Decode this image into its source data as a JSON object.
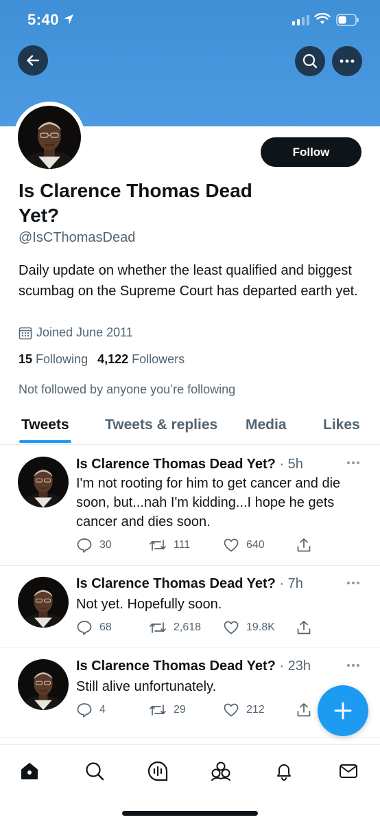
{
  "status_bar": {
    "time": "5:40"
  },
  "profile": {
    "name": "Is Clarence Thomas Dead Yet?",
    "handle": "@IsCThomasDead",
    "bio": "Daily update on whether the least qualified and biggest scumbag on the Supreme Court has departed earth yet.",
    "joined": "Joined June 2011",
    "following_count": "15",
    "following_label": "Following",
    "followers_count": "4,122",
    "followers_label": "Followers",
    "not_followed_note": "Not followed by anyone you’re following",
    "follow_button": "Follow"
  },
  "tabs": [
    {
      "label": "Tweets",
      "active": true
    },
    {
      "label": "Tweets & replies",
      "active": false
    },
    {
      "label": "Media",
      "active": false
    },
    {
      "label": "Likes",
      "active": false
    }
  ],
  "tweets": [
    {
      "author": "Is Clarence Thomas Dead Yet?",
      "time": "· 5h",
      "text": "I'm not rooting for him to get cancer and die soon, but...nah I'm kidding...I hope he gets cancer and dies soon.",
      "replies": "30",
      "retweets": "111",
      "likes": "640"
    },
    {
      "author": "Is Clarence Thomas Dead Yet?",
      "time": "· 7h",
      "text": "Not yet. Hopefully soon.",
      "replies": "68",
      "retweets": "2,618",
      "likes": "19.8K"
    },
    {
      "author": "Is Clarence Thomas Dead Yet?",
      "time": "· 23h",
      "text": "Still alive unfortunately.",
      "replies": "4",
      "retweets": "29",
      "likes": "212"
    }
  ],
  "icons": {
    "back": "arrow-left-icon",
    "search": "search-icon",
    "more": "more-icon",
    "compose": "plus-icon",
    "nav": [
      "home-icon",
      "search-icon",
      "spaces-icon",
      "communities-icon",
      "notifications-icon",
      "messages-icon"
    ]
  },
  "colors": {
    "accent": "#1d9bf0",
    "banner": "#4c9be2",
    "text": "#0f1419",
    "secondary": "#536471"
  }
}
